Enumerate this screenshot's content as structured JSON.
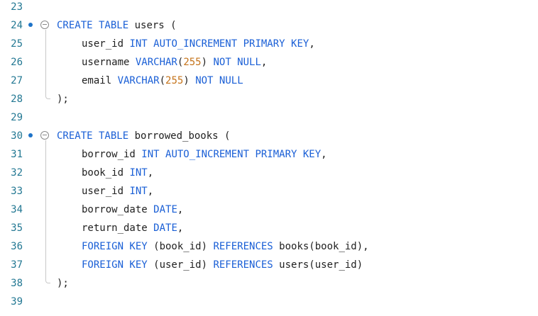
{
  "editor": {
    "lines": [
      {
        "num": "23",
        "tokens": []
      },
      {
        "num": "24",
        "marker": true,
        "fold": true,
        "indent": 0,
        "tokens": [
          {
            "t": "CREATE TABLE",
            "c": "kw"
          },
          {
            "t": " users (",
            "c": ""
          }
        ]
      },
      {
        "num": "25",
        "indent": 1,
        "tokens": [
          {
            "t": "user_id ",
            "c": ""
          },
          {
            "t": "INT AUTO_INCREMENT PRIMARY KEY",
            "c": "kw"
          },
          {
            "t": ",",
            "c": ""
          }
        ]
      },
      {
        "num": "26",
        "indent": 1,
        "tokens": [
          {
            "t": "username ",
            "c": ""
          },
          {
            "t": "VARCHAR",
            "c": "kw"
          },
          {
            "t": "(",
            "c": ""
          },
          {
            "t": "255",
            "c": "num"
          },
          {
            "t": ") ",
            "c": ""
          },
          {
            "t": "NOT NULL",
            "c": "kw"
          },
          {
            "t": ",",
            "c": ""
          }
        ]
      },
      {
        "num": "27",
        "indent": 1,
        "tokens": [
          {
            "t": "email ",
            "c": ""
          },
          {
            "t": "VARCHAR",
            "c": "kw"
          },
          {
            "t": "(",
            "c": ""
          },
          {
            "t": "255",
            "c": "num"
          },
          {
            "t": ") ",
            "c": ""
          },
          {
            "t": "NOT NULL",
            "c": "kw"
          }
        ]
      },
      {
        "num": "28",
        "indent": 0,
        "tokens": [
          {
            "t": ");",
            "c": ""
          }
        ]
      },
      {
        "num": "29",
        "tokens": []
      },
      {
        "num": "30",
        "marker": true,
        "fold": true,
        "indent": 0,
        "tokens": [
          {
            "t": "CREATE TABLE",
            "c": "kw"
          },
          {
            "t": " borrowed_books (",
            "c": ""
          }
        ]
      },
      {
        "num": "31",
        "indent": 1,
        "tokens": [
          {
            "t": "borrow_id ",
            "c": ""
          },
          {
            "t": "INT AUTO_INCREMENT PRIMARY KEY",
            "c": "kw"
          },
          {
            "t": ",",
            "c": ""
          }
        ]
      },
      {
        "num": "32",
        "indent": 1,
        "tokens": [
          {
            "t": "book_id ",
            "c": ""
          },
          {
            "t": "INT",
            "c": "kw"
          },
          {
            "t": ",",
            "c": ""
          }
        ]
      },
      {
        "num": "33",
        "indent": 1,
        "tokens": [
          {
            "t": "user_id ",
            "c": ""
          },
          {
            "t": "INT",
            "c": "kw"
          },
          {
            "t": ",",
            "c": ""
          }
        ]
      },
      {
        "num": "34",
        "indent": 1,
        "tokens": [
          {
            "t": "borrow_date ",
            "c": ""
          },
          {
            "t": "DATE",
            "c": "kw"
          },
          {
            "t": ",",
            "c": ""
          }
        ]
      },
      {
        "num": "35",
        "indent": 1,
        "tokens": [
          {
            "t": "return_date ",
            "c": ""
          },
          {
            "t": "DATE",
            "c": "kw"
          },
          {
            "t": ",",
            "c": ""
          }
        ]
      },
      {
        "num": "36",
        "indent": 1,
        "tokens": [
          {
            "t": "FOREIGN KEY",
            "c": "kw"
          },
          {
            "t": " (book_id) ",
            "c": ""
          },
          {
            "t": "REFERENCES",
            "c": "kw"
          },
          {
            "t": " books(book_id),",
            "c": ""
          }
        ]
      },
      {
        "num": "37",
        "indent": 1,
        "tokens": [
          {
            "t": "FOREIGN KEY",
            "c": "kw"
          },
          {
            "t": " (user_id) ",
            "c": ""
          },
          {
            "t": "REFERENCES",
            "c": "kw"
          },
          {
            "t": " users(user_id)",
            "c": ""
          }
        ]
      },
      {
        "num": "38",
        "indent": 0,
        "tokens": [
          {
            "t": ");",
            "c": ""
          }
        ]
      },
      {
        "num": "39",
        "tokens": []
      }
    ]
  },
  "colors": {
    "keyword": "#1a5fd6",
    "number": "#c5731a",
    "line_number": "#237893",
    "breakpoint_marker": "#1e73c8"
  }
}
